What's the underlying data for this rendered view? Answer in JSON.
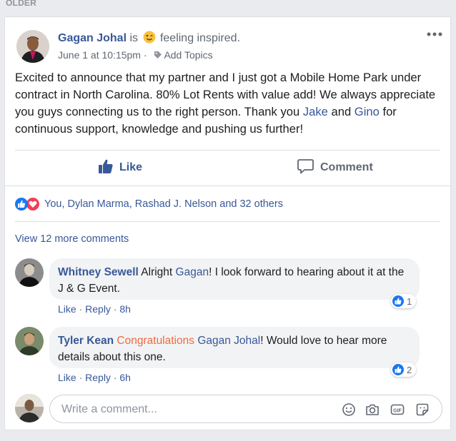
{
  "section": {
    "label": "OLDER"
  },
  "post": {
    "author": "Gagan Johal",
    "verb": "is",
    "feeling": "feeling inspired.",
    "date": "June 1 at 10:15pm",
    "separator": "·",
    "add_topics": "Add Topics",
    "body_part1": "Excited to announce that my partner and I just got a Mobile Home Park under contract in North Carolina. 80% Lot Rents with value add! We always appreciate you guys connecting us to the right person. Thank you ",
    "mention1": "Jake",
    "body_and": " and ",
    "mention2": "Gino",
    "body_part2": " for continuous support, knowledge and pushing us further!"
  },
  "actions": {
    "like": "Like",
    "comment": "Comment"
  },
  "reactions": {
    "summary": "You, Dylan Marma, Rashad J. Nelson and 32 others"
  },
  "comments_section": {
    "view_more": "View 12 more comments"
  },
  "comments": [
    {
      "author": "Whitney Sewell",
      "text_before": " Alright ",
      "mention": "Gagan",
      "text_after": "! I look forward to hearing about it at the J & G Event.",
      "like": "Like",
      "reply": "Reply",
      "dot": "·",
      "time": "8h",
      "reaction_count": "1"
    },
    {
      "author": "Tyler Kean",
      "highlight": "Congratulations",
      "mention": "Gagan Johal",
      "text_after": "! Would love to hear more details about this one.",
      "like": "Like",
      "reply": "Reply",
      "dot": "·",
      "time": "6h",
      "reaction_count": "2"
    }
  ],
  "composer": {
    "placeholder": "Write a comment..."
  },
  "icons": {
    "feeling": "winking-face-emoji",
    "tag": "tag-icon",
    "more": "ellipsis-icon",
    "like": "thumbs-up-icon",
    "comment": "speech-bubble-icon",
    "emoji": "smiley-icon",
    "camera": "camera-icon",
    "gif": "gif-icon",
    "sticker": "sticker-icon"
  },
  "colors": {
    "link": "#385898",
    "like_blue": "#1877f2",
    "love_red": "#f33e58",
    "highlight_orange": "#f06b3f",
    "bubble": "#f2f3f5"
  }
}
